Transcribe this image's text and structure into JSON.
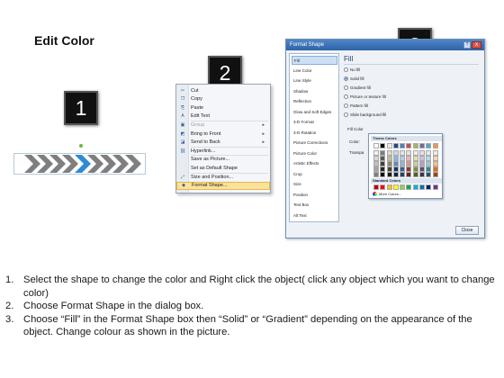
{
  "slide": {
    "title": "Edit Color"
  },
  "badges": [
    "1",
    "2",
    "3"
  ],
  "chevrons": {
    "count": 9,
    "highlighted_index": 4,
    "colors": {
      "normal": "#7f7f7f",
      "highlight": "#2f8bd4"
    }
  },
  "context_menu": {
    "items": [
      {
        "label": "Cut",
        "icon": "scissors-icon",
        "disabled": false,
        "submenu": false
      },
      {
        "label": "Copy",
        "icon": "copy-icon",
        "disabled": false,
        "submenu": false
      },
      {
        "label": "Paste",
        "icon": "paste-icon",
        "disabled": false,
        "submenu": false
      },
      {
        "label": "Edit Text",
        "icon": "edit-text-icon",
        "disabled": false,
        "submenu": false
      },
      {
        "label": "Group",
        "icon": "group-icon",
        "disabled": true,
        "submenu": true
      },
      {
        "label": "Bring to Front",
        "icon": "bring-front-icon",
        "disabled": false,
        "submenu": true
      },
      {
        "label": "Send to Back",
        "icon": "send-back-icon",
        "disabled": false,
        "submenu": true
      },
      {
        "label": "Hyperlink...",
        "icon": "hyperlink-icon",
        "disabled": false,
        "submenu": false
      },
      {
        "label": "Save as Picture...",
        "icon": "",
        "disabled": false,
        "submenu": false
      },
      {
        "label": "Set as Default Shape",
        "icon": "",
        "disabled": false,
        "submenu": false
      },
      {
        "label": "Size and Position...",
        "icon": "size-icon",
        "disabled": false,
        "submenu": false
      },
      {
        "label": "Format Shape...",
        "icon": "format-shape-icon",
        "disabled": false,
        "submenu": false,
        "highlighted": true
      }
    ]
  },
  "dialog": {
    "title": "Format Shape",
    "help": "?",
    "close_x": "X",
    "nav": [
      "Fill",
      "Line Color",
      "Line Style",
      "Shadow",
      "Reflection",
      "Glow and Soft Edges",
      "3-D Format",
      "3-D Rotation",
      "Picture Corrections",
      "Picture Color",
      "Artistic Effects",
      "Crop",
      "Size",
      "Position",
      "Text Box",
      "Alt Text"
    ],
    "selected_nav": "Fill",
    "pane_heading": "Fill",
    "fill_options": [
      {
        "label": "No fill",
        "checked": false
      },
      {
        "label": "Solid fill",
        "checked": true
      },
      {
        "label": "Gradient fill",
        "checked": false
      },
      {
        "label": "Picture or texture fill",
        "checked": false
      },
      {
        "label": "Pattern fill",
        "checked": false
      },
      {
        "label": "Slide background fill",
        "checked": false
      }
    ],
    "fill_color_label": "Fill Color",
    "color_label": "Color:",
    "transparency_label": "Transpa",
    "close_button": "Close"
  },
  "palette": {
    "theme_heading": "Theme Colors",
    "standard_heading": "Standard Colors",
    "more_colors": "More Colors...",
    "theme_row": [
      "#ffffff",
      "#000000",
      "#eeece1",
      "#1f497d",
      "#4f81bd",
      "#c0504d",
      "#9bbb59",
      "#8064a2",
      "#4bacc6",
      "#f79646"
    ],
    "theme_shades": [
      [
        "#f2f2f2",
        "#7f7f7f",
        "#ddd9c3",
        "#c6d9f0",
        "#dbe5f1",
        "#f2dcdb",
        "#ebf1dd",
        "#e5e0ec",
        "#dbeef3",
        "#fdeada"
      ],
      [
        "#d8d8d8",
        "#595959",
        "#c4bd97",
        "#8db3e2",
        "#b8cce4",
        "#e5b9b7",
        "#d7e3bc",
        "#ccc1d9",
        "#b7dde8",
        "#fbd5b5"
      ],
      [
        "#bfbfbf",
        "#3f3f3f",
        "#938953",
        "#548dd4",
        "#95b3d7",
        "#d99694",
        "#c3d69b",
        "#b2a2c7",
        "#92cddc",
        "#fac08f"
      ],
      [
        "#a5a5a5",
        "#262626",
        "#494429",
        "#17365d",
        "#366092",
        "#953734",
        "#76923c",
        "#5f497a",
        "#31859b",
        "#e36c09"
      ],
      [
        "#7f7f7f",
        "#0c0c0c",
        "#1d1b10",
        "#0f243e",
        "#244061",
        "#632423",
        "#4f6128",
        "#3f3151",
        "#205867",
        "#974806"
      ]
    ],
    "standard_row": [
      "#c00000",
      "#ff0000",
      "#ffc000",
      "#ffff00",
      "#92d050",
      "#00b050",
      "#00b0f0",
      "#0070c0",
      "#002060",
      "#7030a0"
    ]
  },
  "instructions": [
    {
      "num": "1.",
      "text": "Select the shape to change the color and Right click the object( click any object which you want to change color)"
    },
    {
      "num": "2.",
      "text": "Choose Format Shape in the dialog box."
    },
    {
      "num": "3.",
      "text": "Choose “Fill” in the Format Shape box then “Solid” or “Gradient” depending on the appearance of the object. Change colour as shown in the picture."
    }
  ]
}
